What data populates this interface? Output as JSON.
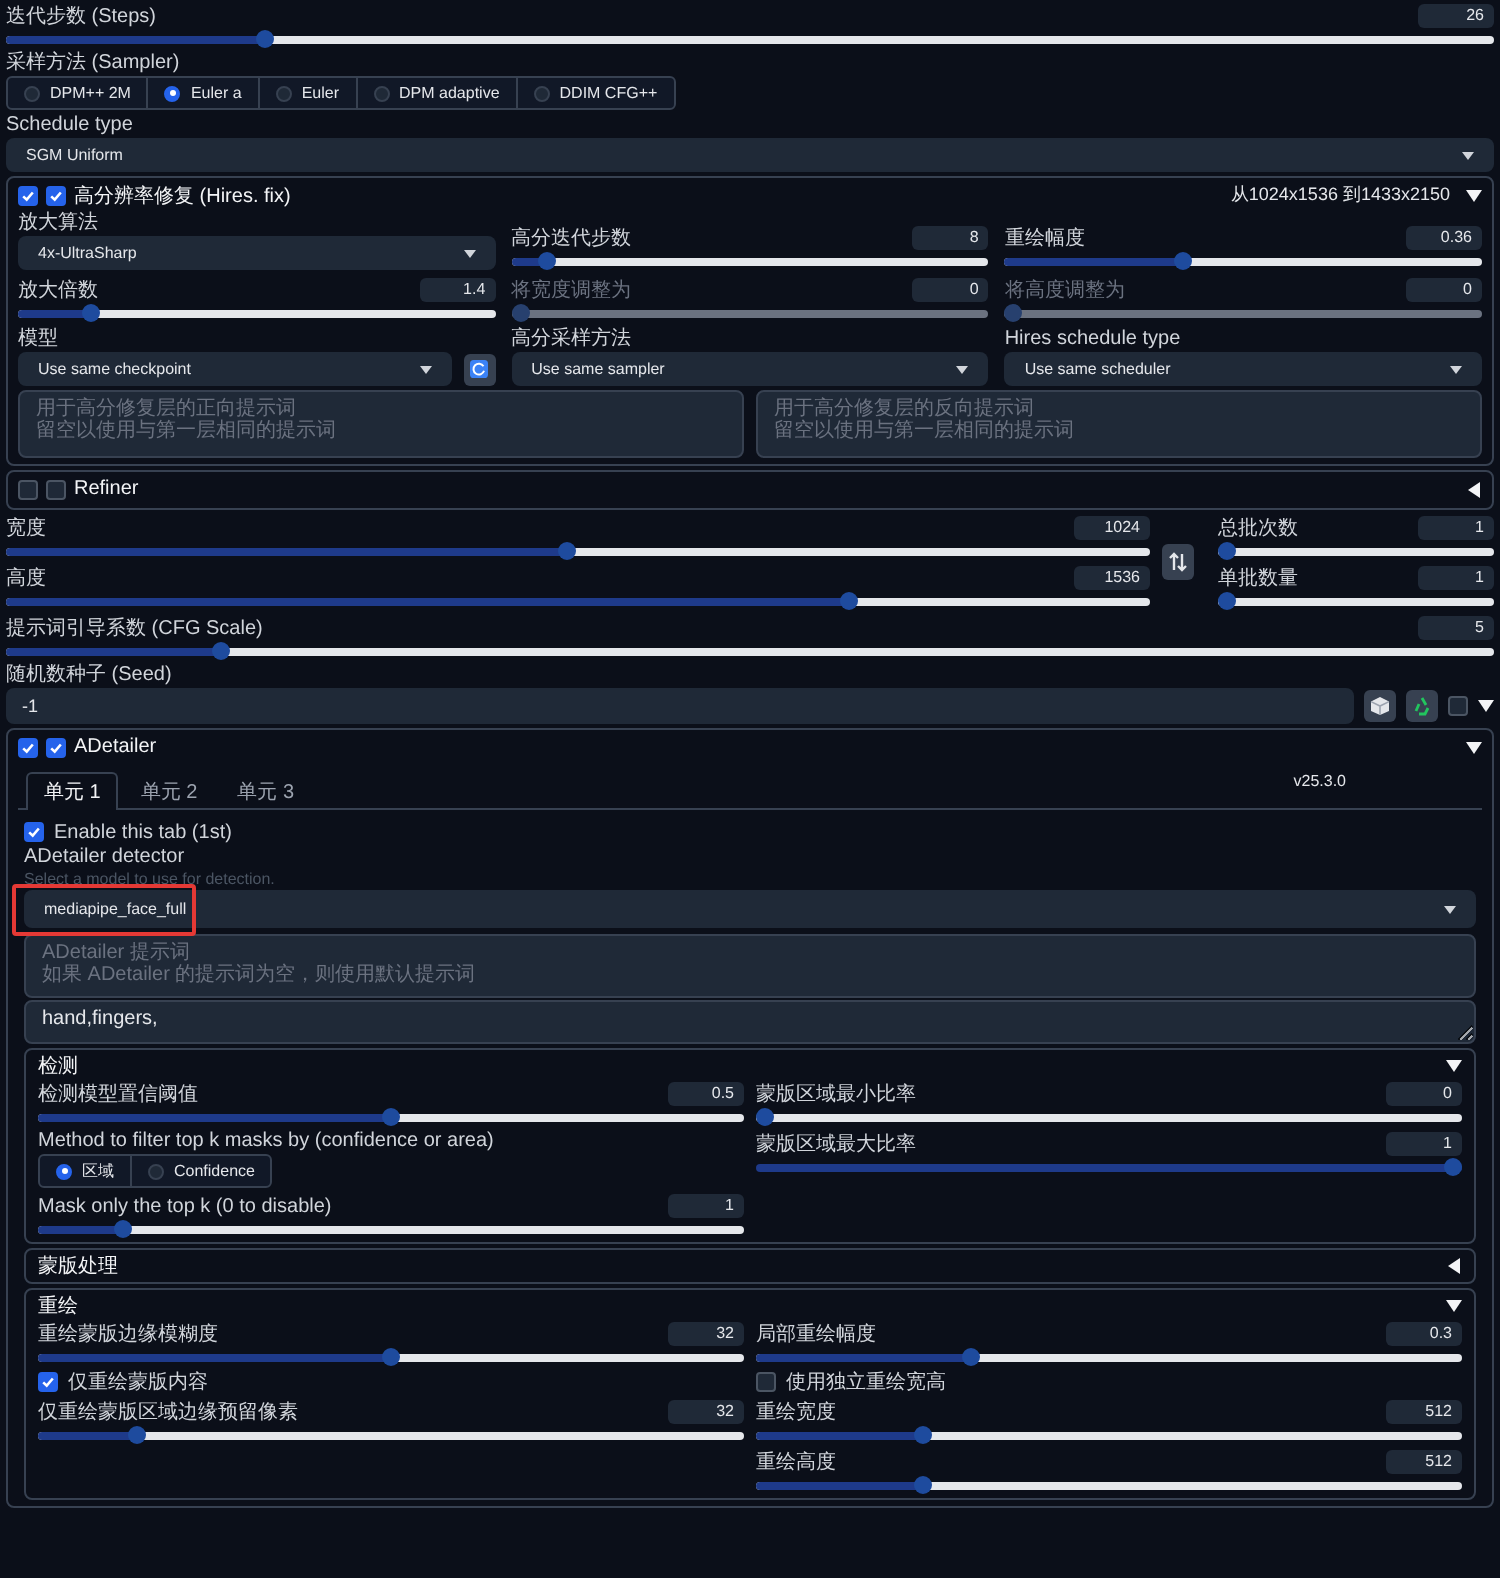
{
  "top": [
    {
      "kind": "slider",
      "label": "迭代步数 (Steps)",
      "value": "26",
      "level": 0.17
    },
    {
      "kind": "radio",
      "label": "采样方法 (Sampler)",
      "options": [
        {
          "label": "DPM++ 2M",
          "selected": false
        },
        {
          "label": "Euler a",
          "selected": true
        },
        {
          "label": "Euler",
          "selected": false
        },
        {
          "label": "DPM adaptive",
          "selected": false
        },
        {
          "label": "DDIM CFG++",
          "selected": false
        }
      ]
    },
    {
      "kind": "dropdown",
      "label": "Schedule type",
      "value": "SGM Uniform"
    }
  ],
  "hires_fix": {
    "checkboxes": [
      {
        "checked": true
      },
      {
        "checked": true
      }
    ],
    "title": "高分辨率修复 (Hires. fix)",
    "info": "从1024x1536 到1433x2150",
    "expanded": true,
    "rows": [
      [
        {
          "kind": "dropdown",
          "label": "放大算法",
          "value": "4x-UltraSharp"
        },
        {
          "kind": "slider",
          "label": "高分迭代步数",
          "value": "8",
          "level": 0.06,
          "disabled": false
        },
        {
          "kind": "slider",
          "label": "重绘幅度",
          "value": "0.36",
          "level": 0.37,
          "disabled": false
        }
      ],
      [
        {
          "kind": "slider",
          "label": "放大倍数",
          "value": "1.4",
          "level": 0.14,
          "disabled": false
        },
        {
          "kind": "slider",
          "label": "将宽度调整为",
          "value": "0",
          "level": 0,
          "disabled": true
        },
        {
          "kind": "slider",
          "label": "将高度调整为",
          "value": "0",
          "level": 0,
          "disabled": true
        }
      ],
      [
        {
          "kind": "dropdown",
          "label": "模型",
          "value": "Use same checkpoint",
          "refresh_button": true
        },
        {
          "kind": "dropdown",
          "label": "高分采样方法",
          "value": "Use same sampler"
        },
        {
          "kind": "dropdown",
          "label": "Hires schedule type",
          "value": "Use same scheduler"
        }
      ]
    ],
    "prompts": [
      {
        "placeholder_lines": [
          "用于高分修复层的正向提示词",
          "留空以使用与第一层相同的提示词"
        ]
      },
      {
        "placeholder_lines": [
          "用于高分修复层的反向提示词",
          "留空以使用与第一层相同的提示词"
        ]
      }
    ]
  },
  "refiner": {
    "checkboxes": [
      {
        "checked": false
      },
      {
        "checked": false
      }
    ],
    "title": "Refiner",
    "expanded": false
  },
  "size": {
    "left": [
      {
        "kind": "slider",
        "label": "宽度",
        "value": "1024",
        "level": 0.49
      },
      {
        "kind": "slider",
        "label": "高度",
        "value": "1536",
        "level": 0.74
      }
    ],
    "right": [
      {
        "kind": "slider",
        "label": "总批次数",
        "value": "1",
        "level": 0
      },
      {
        "kind": "slider",
        "label": "单批数量",
        "value": "1",
        "level": 0
      }
    ]
  },
  "cfg": {
    "kind": "slider",
    "label": "提示词引导系数 (CFG Scale)",
    "value": "5",
    "level": 0.14
  },
  "seed": {
    "label": "随机数种子 (Seed)",
    "value": "-1",
    "extra_checked": false
  },
  "adetailer": {
    "checkboxes": [
      {
        "checked": true
      },
      {
        "checked": true
      }
    ],
    "title": "ADetailer",
    "expanded": true,
    "version": "v25.3.0",
    "tabs": [
      {
        "label": "单元 1",
        "selected": true
      },
      {
        "label": "单元 2",
        "selected": false
      },
      {
        "label": "单元 3",
        "selected": false
      }
    ],
    "enable": {
      "label": "Enable this tab (1st)",
      "checked": true
    },
    "detector_label": "ADetailer detector",
    "detector_hint": "Select a model to use for detection.",
    "detector_value": "mediapipe_face_full",
    "highlighted": true,
    "prompt_placeholder_lines": [
      "ADetailer 提示词",
      "如果 ADetailer 的提示词为空，则使用默认提示词"
    ],
    "negative_prompt_value": "hand,fingers,",
    "sections": [
      {
        "title": "检测",
        "expanded": true,
        "left": [
          {
            "kind": "slider",
            "label": "检测模型置信阈值",
            "value": "0.5",
            "level": 0.5
          },
          {
            "kind": "radio",
            "label": "Method to filter top k masks by (confidence or area)",
            "options": [
              {
                "label": "区域",
                "selected": true
              },
              {
                "label": "Confidence",
                "selected": false
              }
            ]
          },
          {
            "kind": "slider",
            "label": "Mask only the top k (0 to disable)",
            "value": "1",
            "level": 0.11
          }
        ],
        "right": [
          {
            "kind": "slider",
            "label": "蒙版区域最小比率",
            "value": "0",
            "level": 0
          },
          {
            "kind": "slider",
            "label": "蒙版区域最大比率",
            "value": "1",
            "level": 1
          }
        ]
      },
      {
        "title": "蒙版处理",
        "expanded": false
      },
      {
        "title": "重绘",
        "expanded": true,
        "left": [
          {
            "kind": "slider",
            "label": "重绘蒙版边缘模糊度",
            "value": "32",
            "level": 0.5
          },
          {
            "kind": "checkbox",
            "label": "仅重绘蒙版内容",
            "checked": true
          },
          {
            "kind": "slider",
            "label": "仅重绘蒙版区域边缘预留像素",
            "value": "32",
            "level": 0.13
          }
        ],
        "right": [
          {
            "kind": "slider",
            "label": "局部重绘幅度",
            "value": "0.3",
            "level": 0.3
          },
          {
            "kind": "checkbox",
            "label": "使用独立重绘宽高",
            "checked": false
          },
          {
            "kind": "slider",
            "label": "重绘宽度",
            "value": "512",
            "level": 0.23
          },
          {
            "kind": "slider",
            "label": "重绘高度",
            "value": "512",
            "level": 0.23
          }
        ]
      }
    ]
  }
}
